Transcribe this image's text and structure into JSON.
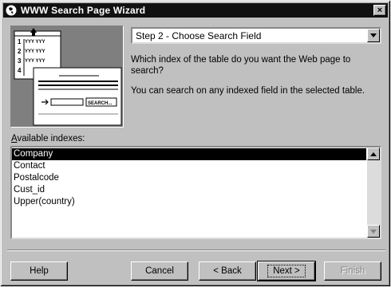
{
  "window": {
    "title": "WWW Search Page Wizard",
    "close_label": "×"
  },
  "step_select": {
    "value": "Step 2 - Choose Search Field"
  },
  "description": {
    "question": "Which index of the table do you want the Web page to search?",
    "info": "You can search on any indexed field in the selected table."
  },
  "indexes": {
    "label": "Available indexes:",
    "items": [
      "Company",
      "Contact",
      "Postalcode",
      "Cust_id",
      "Upper(country)"
    ],
    "selected": "Company"
  },
  "preview": {
    "row_numbers": [
      "1",
      "2",
      "3",
      "4"
    ],
    "row_text": "YYY YYY",
    "search_button": "SEARCH..."
  },
  "buttons": {
    "help": "Help",
    "cancel": "Cancel",
    "back": "< Back",
    "next": "Next >",
    "finish": "Finish"
  }
}
